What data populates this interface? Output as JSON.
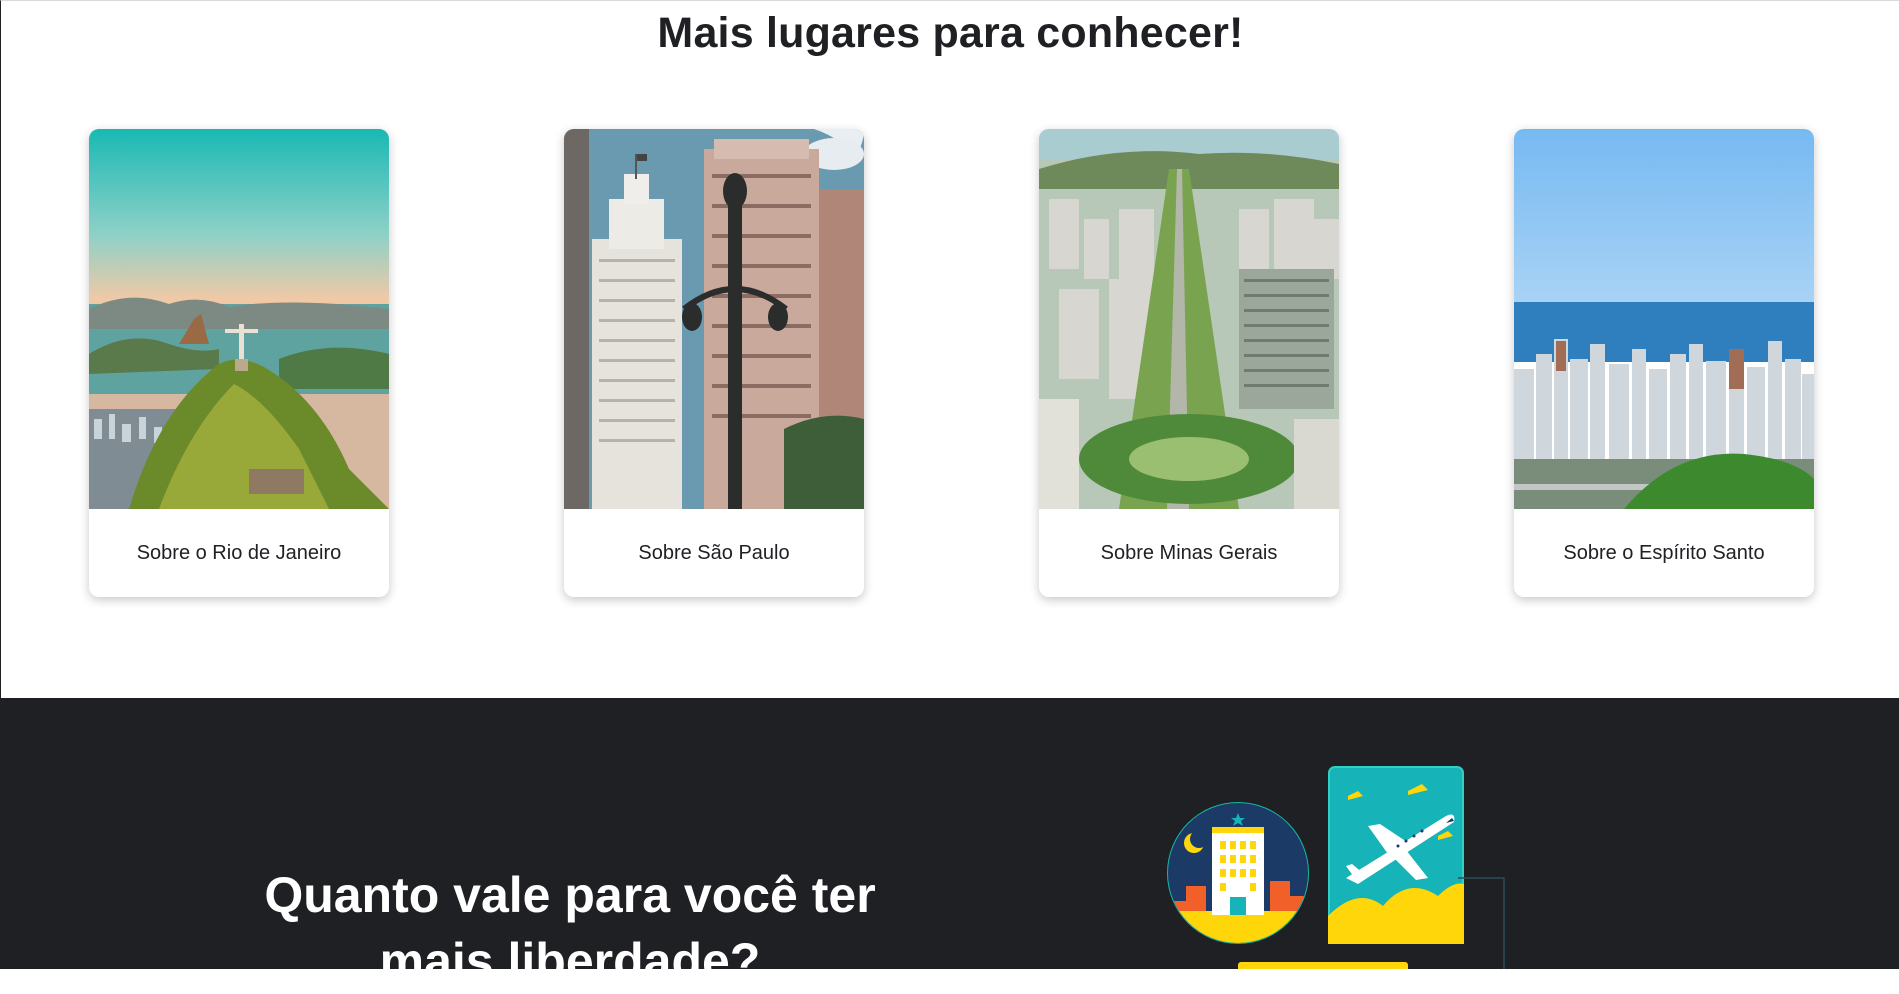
{
  "places": {
    "title": "Mais lugares para conhecer!",
    "cards": [
      {
        "label": "Sobre o Rio de Janeiro"
      },
      {
        "label": "Sobre São Paulo"
      },
      {
        "label": "Sobre Minas Gerais"
      },
      {
        "label": "Sobre o Espírito Santo"
      }
    ]
  },
  "promo": {
    "headline_line1": "Quanto vale para você ter",
    "headline_line2": "mais liberdade?"
  },
  "colors": {
    "dark_bg": "#1f2023",
    "accent_yellow": "#ffd60a",
    "accent_teal": "#16b3b8"
  }
}
